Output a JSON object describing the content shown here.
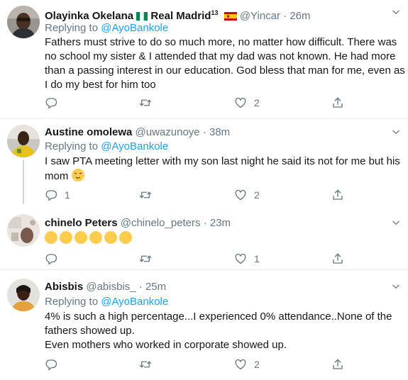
{
  "reply_prefix": "Replying to",
  "tweets": [
    {
      "name": "Olayinka Okelana",
      "name_suffix": "Real Madrid",
      "superscript": "13",
      "handle": "@Yincar",
      "separator": "·",
      "time": "26m",
      "reply_to": "@AyoBankole",
      "lines": [
        "Fathers must strive to do so much more, no matter how difficult. There was",
        "no school my sister & I attended that my dad was not known. He had more",
        "than a passing interest in our education. God bless that man for me, even as",
        "I do my best for him too"
      ],
      "reply_count": "",
      "retweet_count": "",
      "like_count": "2"
    },
    {
      "name": "Austine omolewa",
      "handle": "@uwazunoye",
      "separator": "·",
      "time": "38m",
      "reply_to": "@AyoBankole",
      "lines": [
        "I saw PTA meeting letter with my son last night he said its not for me but his",
        "mom"
      ],
      "reply_count": "1",
      "retweet_count": "",
      "like_count": "2"
    },
    {
      "name": "chinelo Peters",
      "handle": "@chinelo_peters",
      "separator": "·",
      "time": "23m",
      "reply_count": "",
      "retweet_count": "",
      "like_count": "1"
    },
    {
      "name": "Abisbis",
      "handle": "@abisbis_",
      "separator": "·",
      "time": "25m",
      "reply_to": "@AyoBankole",
      "lines": [
        "4% is such a high percentage...I experienced 0% attendance..None of the",
        "fathers showed up.",
        "Even mothers who worked in corporate showed up."
      ],
      "reply_count": "",
      "retweet_count": "",
      "like_count": "2"
    }
  ],
  "colors": {
    "link": "#1da1f2",
    "muted": "#657786",
    "text": "#14171a",
    "separator": "#e6ecf0",
    "thread_line": "#ccd6dd"
  },
  "icons": [
    "reply-icon",
    "retweet-icon",
    "like-icon",
    "share-icon",
    "caret-down-icon",
    "nigeria-flag-icon",
    "spain-flag-icon"
  ]
}
